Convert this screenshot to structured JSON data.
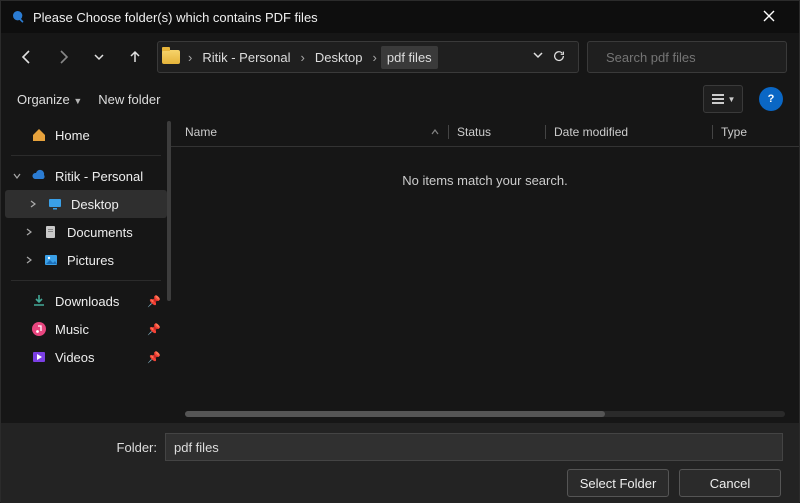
{
  "titlebar": {
    "title": "Please Choose folder(s) which contains PDF files"
  },
  "nav": {
    "back": "←",
    "forward": "→",
    "recent": "v",
    "up": "↑"
  },
  "breadcrumb": {
    "items": [
      "Ritik - Personal",
      "Desktop",
      "pdf files"
    ],
    "selected_index": 2,
    "expand": "v",
    "refresh": "⟳"
  },
  "search": {
    "placeholder": "Search pdf files"
  },
  "orgrow": {
    "organize": "Organize",
    "newfolder": "New folder"
  },
  "columns": {
    "name": "Name",
    "status": "Status",
    "date": "Date modified",
    "type": "Type"
  },
  "content": {
    "empty": "No items match your search."
  },
  "sidebar": {
    "home": "Home",
    "account": "Ritik - Personal",
    "desktop": "Desktop",
    "documents": "Documents",
    "pictures": "Pictures",
    "downloads": "Downloads",
    "music": "Music",
    "videos": "Videos"
  },
  "footer": {
    "label": "Folder:",
    "value": "pdf files",
    "select": "Select Folder",
    "cancel": "Cancel"
  },
  "help": "?"
}
